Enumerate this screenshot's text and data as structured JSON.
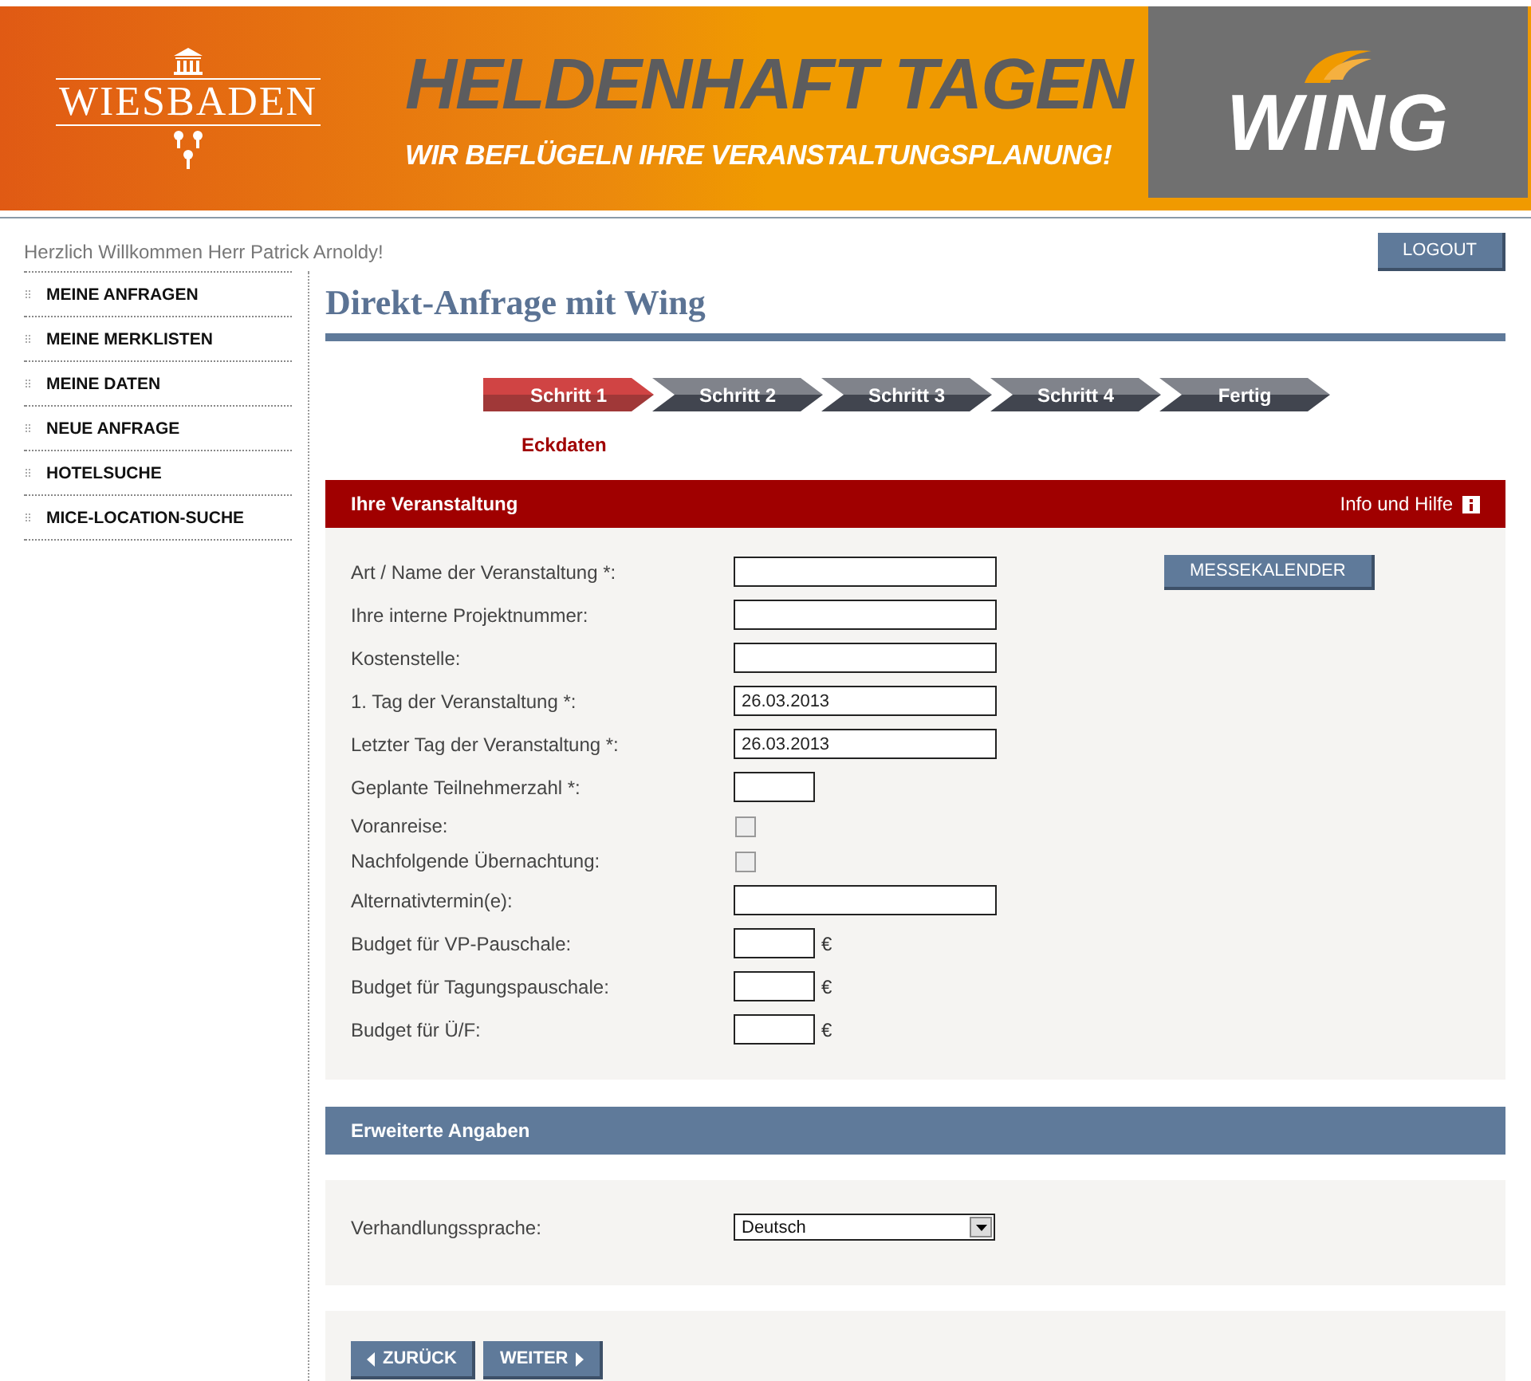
{
  "banner": {
    "city": "WIESBADEN",
    "headline": "HELDENHAFT TAGEN",
    "tagline": "WIR BEFLÜGELN IHRE VERANSTALTUNGSPLANUNG!",
    "brand": "WING"
  },
  "welcome": "Herzlich Willkommen Herr Patrick Arnoldy!",
  "logout": "LOGOUT",
  "sidebar": {
    "items": [
      {
        "label": "MEINE ANFRAGEN"
      },
      {
        "label": "MEINE MERKLISTEN"
      },
      {
        "label": "MEINE DATEN"
      },
      {
        "label": "NEUE ANFRAGE"
      },
      {
        "label": "HOTELSUCHE"
      },
      {
        "label": "MICE-LOCATION-SUCHE"
      }
    ]
  },
  "page_title": "Direkt-Anfrage mit Wing",
  "steps": [
    {
      "label": "Schritt 1",
      "selected": true
    },
    {
      "label": "Schritt 2",
      "selected": false
    },
    {
      "label": "Schritt 3",
      "selected": false
    },
    {
      "label": "Schritt 4",
      "selected": false
    },
    {
      "label": "Fertig",
      "selected": false
    }
  ],
  "step_caption": "Eckdaten",
  "event_section": {
    "title": "Ihre Veranstaltung",
    "help": "Info und Hilfe",
    "calendar_button": "MESSEKALENDER",
    "fields": [
      {
        "label": "Art / Name der Veranstaltung *:",
        "kind": "wide"
      },
      {
        "label": "Ihre interne Projektnummer:",
        "kind": "wide"
      },
      {
        "label": "Kostenstelle:",
        "kind": "wide"
      },
      {
        "label": "1. Tag der Veranstaltung *:",
        "kind": "wide",
        "value": "26.03.2013"
      },
      {
        "label": "Letzter Tag der Veranstaltung *:",
        "kind": "wide",
        "value": "26.03.2013"
      },
      {
        "label": "Geplante Teilnehmerzahl *:",
        "kind": "short"
      },
      {
        "label": "Voranreise:",
        "kind": "checkbox",
        "checked": false
      },
      {
        "label": "Nachfolgende Übernachtung:",
        "kind": "checkbox",
        "checked": false
      },
      {
        "label": "Alternativtermin(e):",
        "kind": "wide"
      },
      {
        "label": "Budget für VP-Pauschale:",
        "kind": "short",
        "unit": "€"
      },
      {
        "label": "Budget für Tagungspauschale:",
        "kind": "short",
        "unit": "€"
      },
      {
        "label": "Budget für Ü/F:",
        "kind": "short",
        "unit": "€"
      }
    ]
  },
  "extended_section": {
    "title": "Erweiterte Angaben",
    "language_label": "Verhandlungssprache:",
    "language_value": "Deutsch"
  },
  "buttons": [
    {
      "label": "ZURÜCK",
      "kind": "back"
    },
    {
      "label": "WEITER",
      "kind": "next"
    }
  ]
}
